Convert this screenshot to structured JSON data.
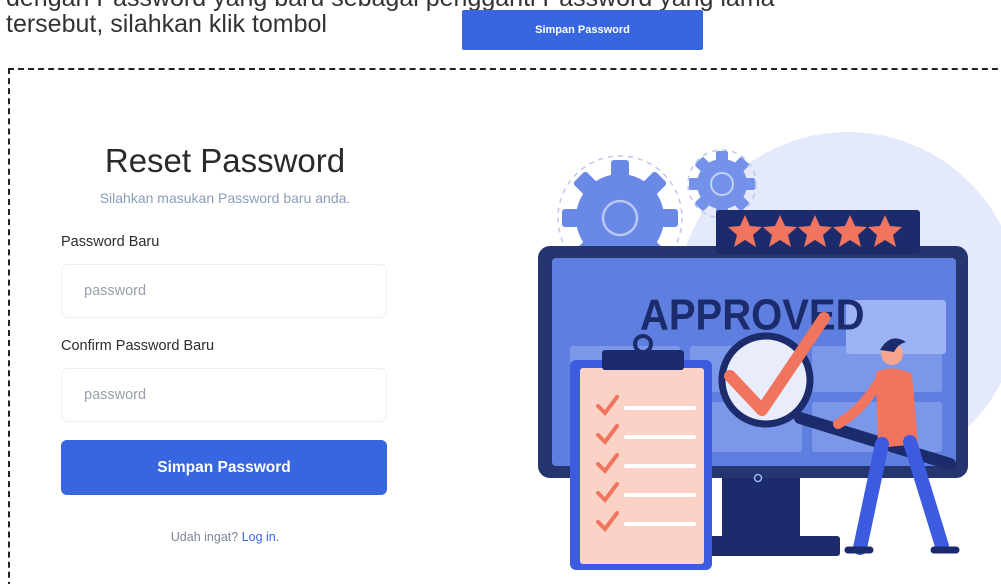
{
  "doc": {
    "top_line": "dengan Password yang baru sebagai pengganti Password yang lama",
    "line": "tersebut, silahkan klik tombol",
    "button_label": "Simpan Password"
  },
  "form": {
    "title": "Reset Password",
    "subtitle": "Silahkan masukan Password baru anda.",
    "new_password_label": "Password Baru",
    "new_password_placeholder": "password",
    "confirm_password_label": "Confirm Password Baru",
    "confirm_password_placeholder": "password",
    "submit_label": "Simpan Password",
    "login_prompt": "Udah ingat?",
    "login_link": "Log in."
  },
  "illustration": {
    "banner_text": "APPROVED",
    "rating_stars": 5,
    "checklist_items": 5
  },
  "colors": {
    "primary": "#3766e0",
    "coral": "#f1745e",
    "navy": "#1c2b6b",
    "light_blue": "#dfe6fb"
  }
}
